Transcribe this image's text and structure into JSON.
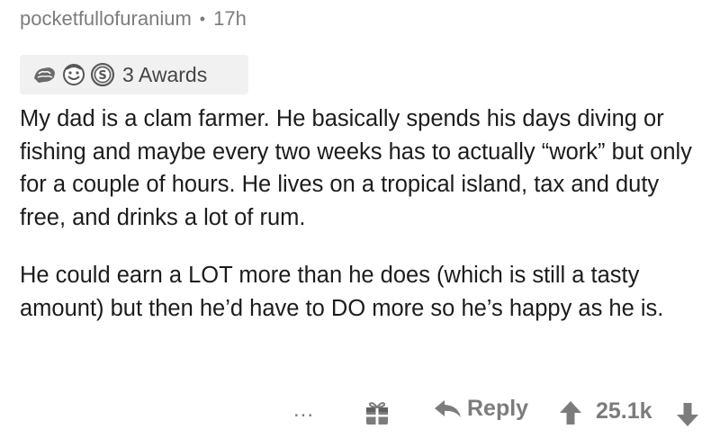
{
  "comment": {
    "username": "pocketfullofuranium",
    "separator": "•",
    "age": "17h",
    "awards": {
      "icons": [
        "helpful-award-icon",
        "wholesome-award-icon",
        "silver-award-icon"
      ],
      "count_label": "3 Awards"
    },
    "paragraphs": [
      "My dad is a clam farmer. He basically spends his days diving or fishing and maybe every two weeks has to actually “work” but only for a couple of hours. He lives on a tropical island, tax and duty free, and drinks a lot of rum.",
      "He could earn a LOT more than he does (which is still a tasty amount) but then he’d have to DO more so he’s happy as he is."
    ]
  },
  "actions": {
    "more": "...",
    "gift_icon": "gift-icon",
    "reply_label": "Reply",
    "score": "25.1k"
  },
  "colors": {
    "meta_gray": "#7c7c7c",
    "awards_bg": "#f1f1f1",
    "text": "#1c1c1c"
  }
}
